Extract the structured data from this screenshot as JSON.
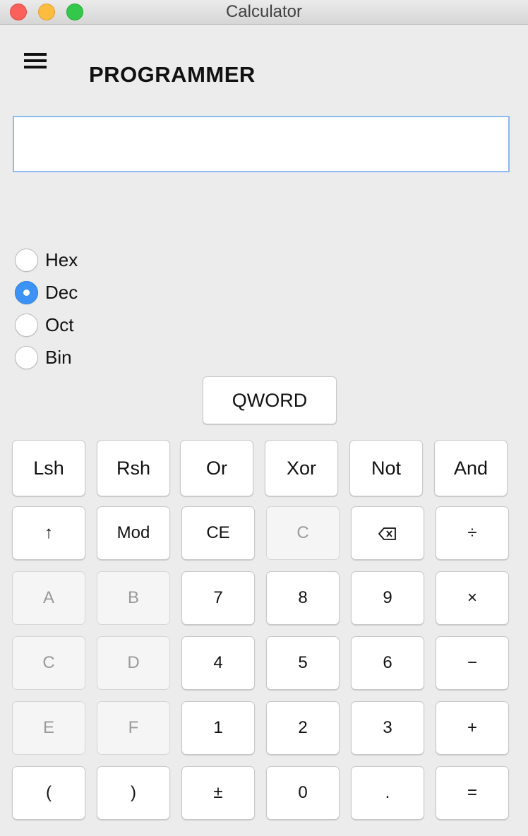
{
  "window": {
    "title": "Calculator"
  },
  "header": {
    "mode_title": "PROGRAMMER"
  },
  "display": {
    "value": ""
  },
  "base_options": [
    {
      "label": "Hex",
      "selected": false
    },
    {
      "label": "Dec",
      "selected": true
    },
    {
      "label": "Oct",
      "selected": false
    },
    {
      "label": "Bin",
      "selected": false
    }
  ],
  "word_size": {
    "label": "QWORD"
  },
  "keys": {
    "row1": [
      "Lsh",
      "Rsh",
      "Or",
      "Xor",
      "Not",
      "And"
    ],
    "row2": [
      "↑",
      "Mod",
      "CE",
      "C",
      "⌫",
      "÷"
    ],
    "row3": [
      "A",
      "B",
      "7",
      "8",
      "9",
      "×"
    ],
    "row4": [
      "C",
      "D",
      "4",
      "5",
      "6",
      "−"
    ],
    "row5": [
      "E",
      "F",
      "1",
      "2",
      "3",
      "+"
    ],
    "row6": [
      "(",
      ")",
      "±",
      "0",
      ".",
      "="
    ]
  },
  "disabled_keys": [
    "row2.3",
    "row3.0",
    "row3.1",
    "row4.0",
    "row4.1",
    "row5.0",
    "row5.1"
  ],
  "colors": {
    "accent": "#3d92f6",
    "display_border": "#8fb9ef",
    "background": "#ececec"
  }
}
